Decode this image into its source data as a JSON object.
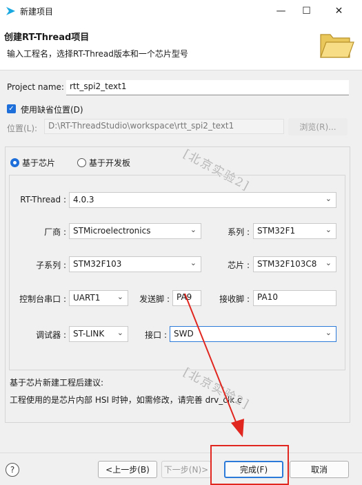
{
  "window": {
    "title": "新建项目",
    "minimize": "—",
    "maximize": "☐",
    "close": "✕"
  },
  "header": {
    "title": "创建RT-Thread项目",
    "subtitle": "输入工程名，选择RT-Thread版本和一个芯片型号"
  },
  "project": {
    "name_label": "Project name:",
    "name_value": "rtt_spi2_text1",
    "use_default_label": "使用缺省位置(D)",
    "use_default_checked": true,
    "location_label": "位置(L):",
    "location_value": "D:\\RT-ThreadStudio\\workspace\\rtt_spi2_text1",
    "browse_label": "浏览(R)..."
  },
  "mode": {
    "chip_label": "基于芯片",
    "board_label": "基于开发板",
    "selected": "chip"
  },
  "fields": {
    "rtthread_label": "RT-Thread :",
    "rtthread_value": "4.0.3",
    "vendor_label": "厂商 :",
    "vendor_value": "STMicroelectronics",
    "series_label": "系列 :",
    "series_value": "STM32F1",
    "subseries_label": "子系列 :",
    "subseries_value": "STM32F103",
    "chip_label": "芯片 :",
    "chip_value": "STM32F103C8",
    "console_label": "控制台串口 :",
    "console_value": "UART1",
    "tx_label": "发送脚 :",
    "tx_value": "PA9",
    "rx_label": "接收脚 :",
    "rx_value": "PA10",
    "debugger_label": "调试器 :",
    "debugger_value": "ST-LINK",
    "interface_label": "接口 :",
    "interface_value": "SWD"
  },
  "advice": {
    "title": "基于芯片新建工程后建议:",
    "text": "工程使用的是芯片内部 HSI 时钟，如需修改，请完善 drv_clk.c"
  },
  "watermark": "[北京实验2]",
  "footer": {
    "help": "?",
    "back_label": "<上一步(B)",
    "next_label": "下一步(N)>",
    "finish_label": "完成(F)",
    "cancel_label": "取消"
  },
  "colors": {
    "accent": "#1e6fd9",
    "annotation_red": "#e0261f"
  }
}
